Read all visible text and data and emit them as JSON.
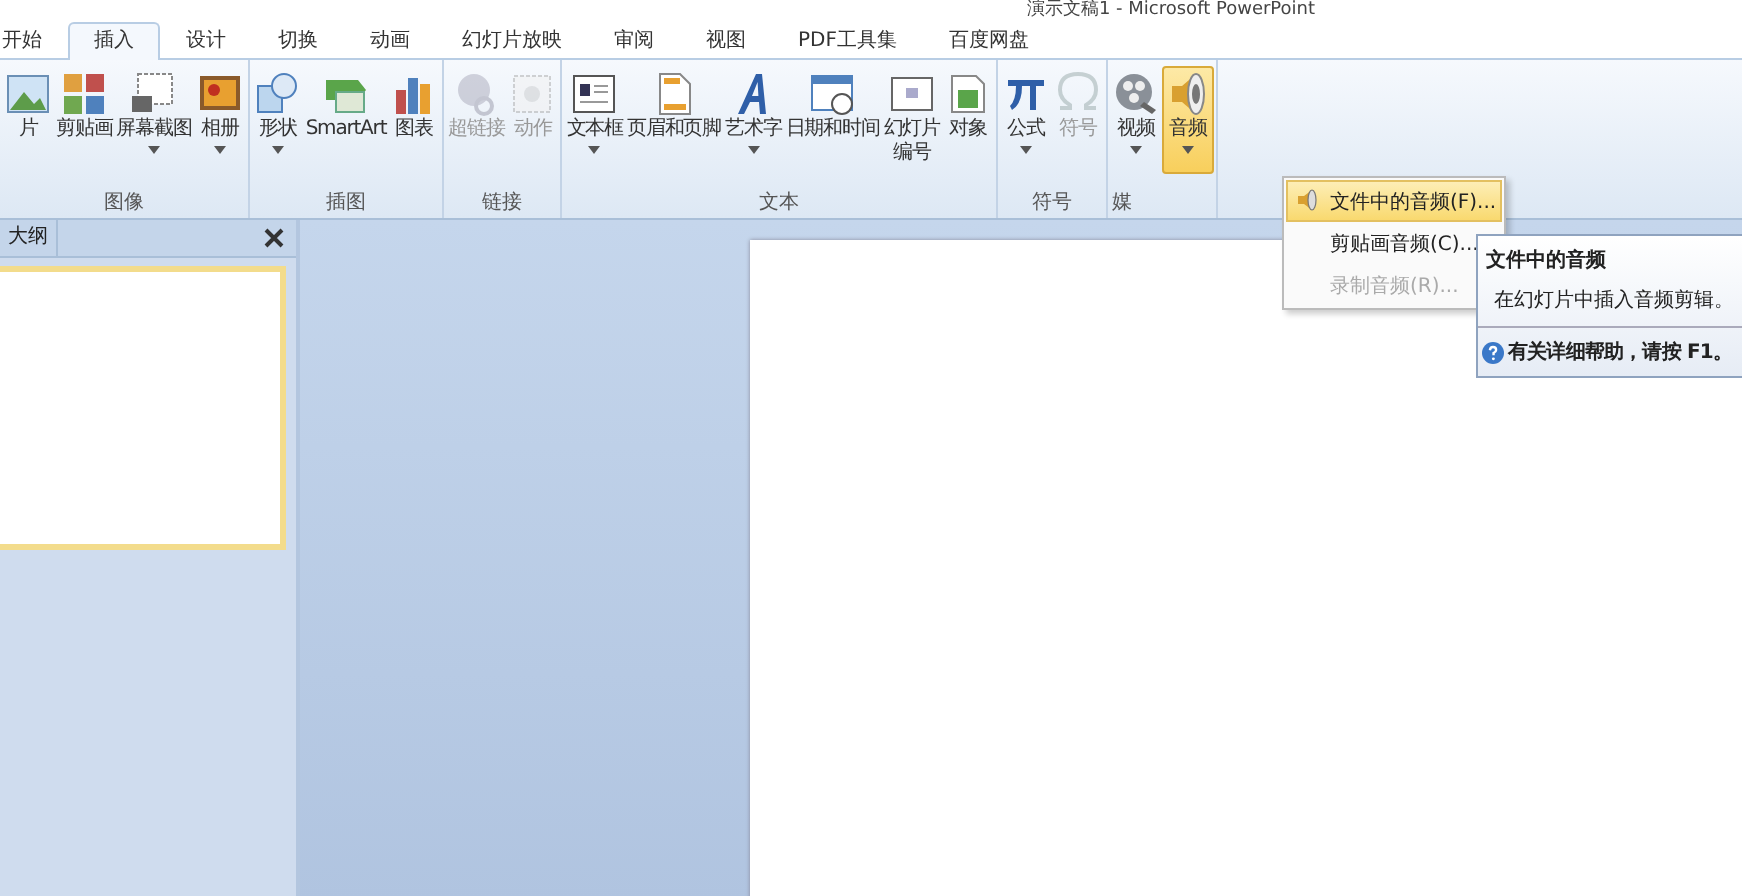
{
  "window": {
    "title": "演示文稿1 - Microsoft PowerPoint"
  },
  "tabs": [
    {
      "label": "开始",
      "selected": false
    },
    {
      "label": "插入",
      "selected": true
    },
    {
      "label": "设计",
      "selected": false
    },
    {
      "label": "切换",
      "selected": false
    },
    {
      "label": "动画",
      "selected": false
    },
    {
      "label": "幻灯片放映",
      "selected": false
    },
    {
      "label": "审阅",
      "selected": false
    },
    {
      "label": "视图",
      "selected": false
    },
    {
      "label": "PDF工具集",
      "selected": false
    },
    {
      "label": "百度网盘",
      "selected": false
    }
  ],
  "ribbon": {
    "groups": [
      {
        "label": "图像",
        "buttons": [
          {
            "label": "片",
            "dropdown": false,
            "disabled": false,
            "selected": false
          },
          {
            "label": "剪贴画",
            "dropdown": false,
            "disabled": false,
            "selected": false
          },
          {
            "label": "屏幕截图",
            "dropdown": true,
            "disabled": false,
            "selected": false
          },
          {
            "label": "相册",
            "dropdown": true,
            "disabled": false,
            "selected": false
          }
        ]
      },
      {
        "label": "插图",
        "buttons": [
          {
            "label": "形状",
            "dropdown": true,
            "disabled": false,
            "selected": false
          },
          {
            "label": "SmartArt",
            "dropdown": false,
            "disabled": false,
            "selected": false
          },
          {
            "label": "图表",
            "dropdown": false,
            "disabled": false,
            "selected": false
          }
        ]
      },
      {
        "label": "链接",
        "buttons": [
          {
            "label": "超链接",
            "dropdown": false,
            "disabled": true,
            "selected": false
          },
          {
            "label": "动作",
            "dropdown": false,
            "disabled": true,
            "selected": false
          }
        ]
      },
      {
        "label": "文本",
        "buttons": [
          {
            "label": "文本框",
            "dropdown": true,
            "disabled": false,
            "selected": false
          },
          {
            "label": "页眉和页脚",
            "dropdown": false,
            "disabled": false,
            "selected": false
          },
          {
            "label": "艺术字",
            "dropdown": true,
            "disabled": false,
            "selected": false
          },
          {
            "label": "日期和时间",
            "dropdown": false,
            "disabled": false,
            "selected": false
          },
          {
            "lines": [
              "幻灯片",
              "编号"
            ],
            "dropdown": false,
            "disabled": false,
            "selected": false
          },
          {
            "label": "对象",
            "dropdown": false,
            "disabled": false,
            "selected": false
          }
        ]
      },
      {
        "label": "符号",
        "buttons": [
          {
            "label": "公式",
            "dropdown": true,
            "disabled": false,
            "selected": false
          },
          {
            "label": "符号",
            "dropdown": false,
            "disabled": true,
            "selected": false
          }
        ]
      },
      {
        "label": "媒",
        "buttons": [
          {
            "label": "视频",
            "dropdown": true,
            "disabled": false,
            "selected": false
          },
          {
            "label": "音频",
            "dropdown": true,
            "disabled": false,
            "selected": true
          }
        ]
      }
    ]
  },
  "left_panel": {
    "tab": "大纲"
  },
  "audio_menu": {
    "items": [
      {
        "label": "文件中的音频(F)...",
        "selected": true,
        "disabled": false
      },
      {
        "label": "剪贴画音频(C)...",
        "selected": false,
        "disabled": false
      },
      {
        "label": "录制音频(R)...",
        "selected": false,
        "disabled": true
      }
    ]
  },
  "tooltip": {
    "title": "文件中的音频",
    "body": "在幻灯片中插入音频剪辑。",
    "help": "有关详细帮助，请按 F1。"
  }
}
